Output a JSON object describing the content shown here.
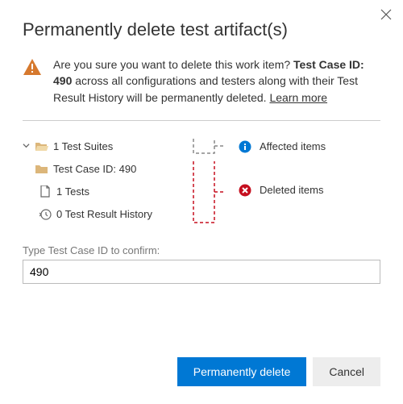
{
  "dialog": {
    "title": "Permanently delete test artifact(s)",
    "close_label": "Close"
  },
  "warning": {
    "prefix": "Are you sure you want to delete this work item? ",
    "strong": "Test Case ID: 490",
    "suffix": " across all configurations and testers along with their Test Result History will be permanently deleted. ",
    "learn_more": "Learn more"
  },
  "tree": {
    "suites": "1 Test Suites",
    "case": "Test Case ID: 490",
    "tests": "1 Tests",
    "history": "0 Test Result History"
  },
  "legend": {
    "affected": "Affected items",
    "deleted": "Deleted items"
  },
  "confirm": {
    "label": "Type Test Case ID to confirm:",
    "value": "490"
  },
  "buttons": {
    "primary": "Permanently delete",
    "cancel": "Cancel"
  },
  "colors": {
    "primary": "#0078d4",
    "warn": "#d6792e",
    "error": "#c50f1f",
    "info": "#0078d4",
    "folder": "#dcb67a"
  },
  "icons": {
    "warning": "warning-triangle",
    "folder_closed": "folder",
    "folder_open": "folder-open",
    "file": "file",
    "history": "history",
    "info": "info-circle",
    "error": "error-circle",
    "chevron": "chevron-down",
    "close": "close"
  }
}
